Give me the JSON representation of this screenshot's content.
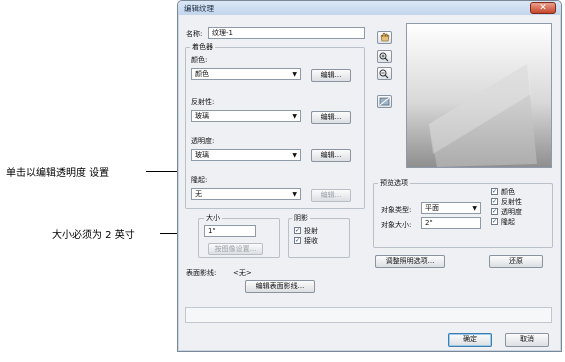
{
  "annotations": {
    "transparency": "单击以编辑透明度 设置",
    "size": "大小必须为 2 英寸"
  },
  "window": {
    "title": "编辑纹理",
    "close_glyph": "✕"
  },
  "name": {
    "label": "名称:",
    "value": "纹理-1"
  },
  "shader": {
    "group_label": "着色器",
    "color": {
      "label": "颜色:",
      "value": "颜色",
      "edit": "编辑..."
    },
    "reflectivity": {
      "label": "反射性:",
      "value": "玻璃",
      "edit": "编辑..."
    },
    "transparency": {
      "label": "透明度:",
      "value": "玻璃",
      "edit": "编辑..."
    },
    "bump": {
      "label": "隆起:",
      "value": "无",
      "edit": "编辑..."
    }
  },
  "size": {
    "group_label": "大小",
    "value": "1\"",
    "from_image_button": "按图像设置..."
  },
  "shadow": {
    "group_label": "阴影",
    "cast": {
      "label": "投射",
      "checked": true
    },
    "receive": {
      "label": "接收",
      "checked": true
    }
  },
  "surface": {
    "label": "表面影线:",
    "value": "<无>",
    "edit_button": "编辑表面影线..."
  },
  "preview_options": {
    "group_label": "预览选项",
    "object_type": {
      "label": "对象类型:",
      "value": "平面"
    },
    "object_size": {
      "label": "对象大小:",
      "value": "2\""
    },
    "checks": [
      {
        "label": "颜色",
        "checked": true
      },
      {
        "label": "反射性",
        "checked": true
      },
      {
        "label": "透明度",
        "checked": true
      },
      {
        "label": "隆起",
        "checked": true
      }
    ],
    "lighting_button": "调整照明选项...",
    "reset_button": "还原"
  },
  "footer": {
    "ok": "确定",
    "cancel": "取消"
  },
  "icons": [
    "hand-pan-icon",
    "zoom-in-icon",
    "zoom-out-icon",
    "light-icon",
    "dropdown-arrow-icon",
    "checkmark-icon"
  ],
  "colors": {
    "window_bg": "#eef0f4",
    "title_gradient": "#c3d5ec",
    "close_button": "#c6452a",
    "accent_blue": "#3c7fb1"
  }
}
